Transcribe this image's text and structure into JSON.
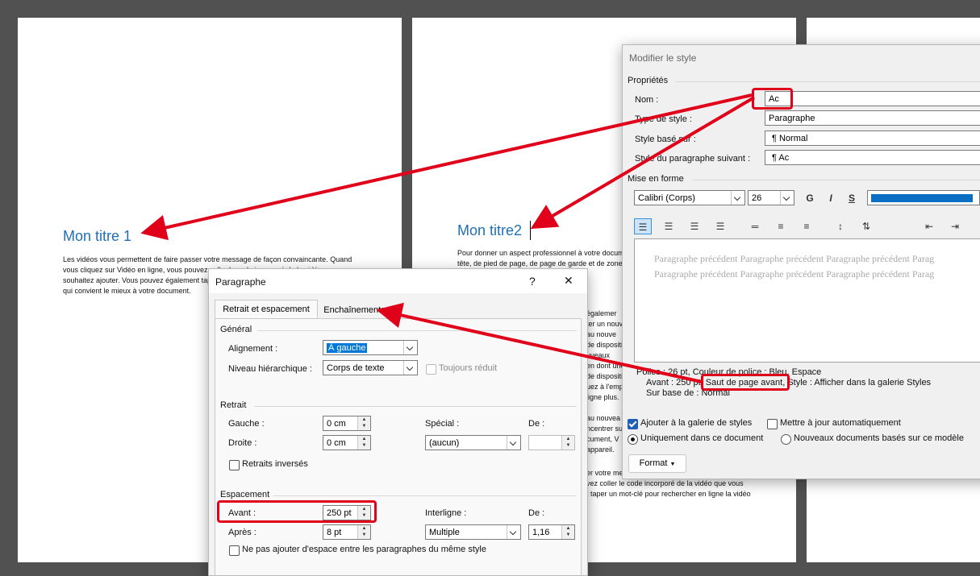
{
  "pages": {
    "p1": {
      "heading": "Mon titre 1",
      "body": "Les vidéos vous permettent de faire passer votre message de façon convaincante. Quand\nvous cliquez sur Vidéo en ligne, vous pouvez coller le code incorporé de la vidéo que vous\nsouhaitez ajouter. Vous pouvez également taper\nqui convient le mieux à votre document."
    },
    "p2": {
      "heading": "Mon titre2",
      "body_top": "Pour donner un aspect professionnel à votre document\ntête, de pied de page, de page de garde et de zone d\n                                                                          nnez les élé",
      "body_right": "égalemer\nter un nouv\nau nouve\nde dispositi\nuveaux\nen dont une\nde dispositi\nuez à l'emp\nligne plus.\n\nau nouvea\nncentrer su\ncument, V\nappareil.",
      "body_bottom": "er votre me\nvez coller le code incorporé de la vidéo que vous\nt taper un mot-clé pour rechercher en ligne la vidéo"
    }
  },
  "modifier_style": {
    "title": "Modifier le style",
    "props_section": "Propriétés",
    "nom_label": "Nom :",
    "nom_value": "Ac",
    "type_label": "Type de style :",
    "type_value": "Paragraphe",
    "base_label": "Style basé sur :",
    "base_value": "¶  Normal",
    "suivant_label": "Style du paragraphe suivant :",
    "suivant_value": "¶  Ac",
    "mise_section": "Mise en forme",
    "font_value": "Calibri (Corps)",
    "size_value": "26",
    "bold": "G",
    "italic": "I",
    "underline": "S",
    "color_hex": "#0a6fc2",
    "preview_text": "Paragraphe précédent Paragraphe précédent Paragraphe précédent Parag\nParagraphe précédent Paragraphe précédent Paragraphe précédent Parag",
    "desc_line1": "Police : 26 pt, Couleur de police : Bleu, Espace",
    "desc_line2_a": "Avant : 250 pt, ",
    "desc_line2_b": "Saut de page avant",
    "desc_line2_c": ", Style : Afficher dans la galerie Styles",
    "desc_line3": "Sur base de : Normal",
    "chk_galerie": "Ajouter à la galerie de styles",
    "chk_maj": "Mettre à jour automatiquement",
    "radio_doc": "Uniquement dans ce document",
    "radio_new": "Nouveaux documents basés sur ce modèle",
    "format_btn": "Format"
  },
  "paragraphe": {
    "title": "Paragraphe",
    "help": "?",
    "close": "✕",
    "tab1": "Retrait et espacement",
    "tab2": "Enchaînements",
    "general": "Général",
    "align_label": "Alignement :",
    "align_value": "À gauche",
    "niveau_label": "Niveau hiérarchique :",
    "niveau_value": "Corps de texte",
    "toujours": "Toujours réduit",
    "retrait": "Retrait",
    "gauche_label": "Gauche :",
    "gauche_value": "0 cm",
    "droite_label": "Droite :",
    "droite_value": "0 cm",
    "special_label": "Spécial :",
    "special_value": "(aucun)",
    "de_label": "De :",
    "de_value": "",
    "retraits_inv": "Retraits inversés",
    "espacement": "Espacement",
    "avant_label": "Avant :",
    "avant_value": "250 pt",
    "apres_label": "Après :",
    "apres_value": "8 pt",
    "interligne_label": "Interligne :",
    "interligne_value": "Multiple",
    "de2_label": "De :",
    "de2_value": "1,16",
    "ne_pas": "Ne pas ajouter d'espace entre les paragraphes du même style"
  },
  "annotation_color": "#e1001a"
}
